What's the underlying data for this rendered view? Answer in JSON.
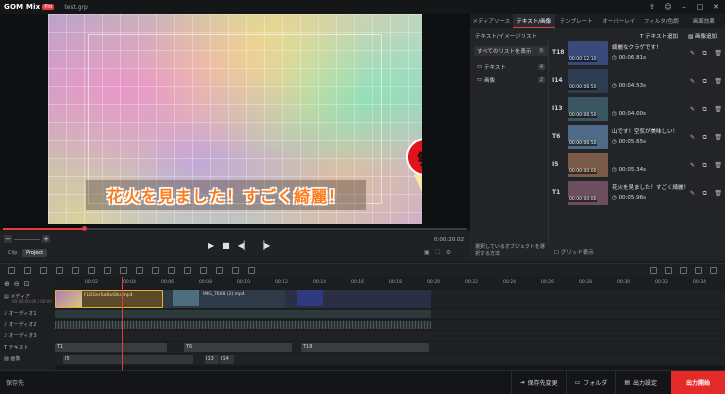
{
  "app": {
    "logo": "GOM Mix",
    "logo_badge": "Pro",
    "file_name": "test.grp"
  },
  "titlebar_icons": [
    "share-icon",
    "user-icon",
    "minimize-icon",
    "maximize-icon",
    "close-icon"
  ],
  "preview": {
    "caption": "花火を見ました！すごく綺麗！",
    "sticker_text": "祭",
    "time_current": "0:00:20.02",
    "zoom_chips": [
      "Clip",
      "Project"
    ],
    "accent": "#e23c3c"
  },
  "right_panel": {
    "tabs": [
      "メディアソース",
      "テキスト/画像",
      "テンプレート",
      "オーバーレイ",
      "フィルタ/色調",
      "画面効果"
    ],
    "active_tab": 1,
    "section_title": "テキスト/イメージリスト",
    "add_text": "テキスト追加",
    "add_image": "画像追加",
    "categories": [
      {
        "label": "すべてのリストを表示",
        "count": "6"
      },
      {
        "label": "テキスト",
        "count": "4"
      },
      {
        "label": "画像",
        "count": "2"
      }
    ],
    "items": [
      {
        "id": "T18",
        "time": "00:00:12:10",
        "text": "綺麗なクラゲです！",
        "duration": "00:06.81s",
        "thumb": "#394a7a"
      },
      {
        "id": "I14",
        "time": "00:00:06:50",
        "text": "",
        "duration": "00:04.53s",
        "thumb": "#2c3c52"
      },
      {
        "id": "I13",
        "time": "00:00:06:50",
        "text": "",
        "duration": "00:04.00s",
        "thumb": "#3a5660"
      },
      {
        "id": "T6",
        "time": "00:00:06:50",
        "text": "山です！空気が美味しい！",
        "duration": "00:05.65s",
        "thumb": "#4e6a86"
      },
      {
        "id": "I5",
        "time": "00:00:00:00",
        "text": "",
        "duration": "00:05.34s",
        "thumb": "#7a5a48"
      },
      {
        "id": "T1",
        "time": "00:00:00:00",
        "text": "花火を見ました！すごく綺麗！",
        "duration": "00:05.96s",
        "thumb": "#6d4e5e"
      }
    ],
    "hint": "選択しているオブジェクトを選択する方法",
    "grid_toggle": "グリッド表示"
  },
  "timeline": {
    "ticks": [
      "00:02",
      "00:04",
      "00:06",
      "00:08",
      "00:10",
      "00:12",
      "00:14",
      "00:16",
      "00:18",
      "00:20",
      "00:22",
      "00:24",
      "00:26",
      "00:28",
      "00:30",
      "00:32",
      "00:34"
    ],
    "tracks": [
      "メディア",
      "オーディオ1",
      "オーディオ2",
      "オーディオ3",
      "テキスト",
      "画像"
    ],
    "media_sub": "00:00:00:00 / 00:00",
    "clip1": "FLOGerSaBwSlkr.mp4",
    "clip2": "IMG_7608 (2).mp4",
    "text_clips": [
      "T1",
      "T6",
      "T18"
    ],
    "image_clips": [
      "I5",
      "I13",
      "I14"
    ]
  },
  "statusbar": {
    "left": "保存先",
    "save_change": "保存先変更",
    "folder": "フォルダ",
    "output_settings": "出力設定",
    "export": "出力開始"
  }
}
